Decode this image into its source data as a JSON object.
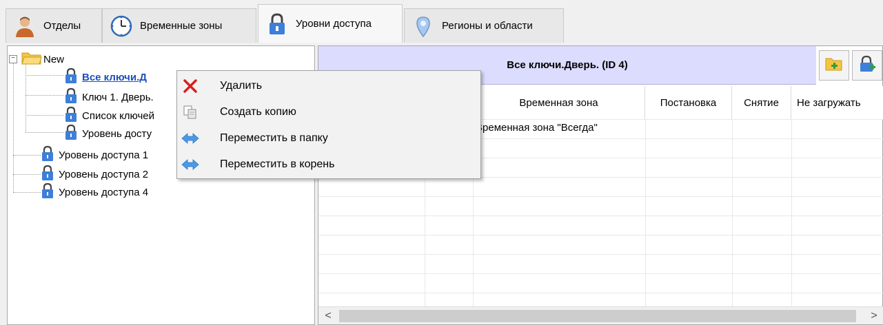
{
  "tabs": [
    {
      "label": "Отделы",
      "icon": "person-icon"
    },
    {
      "label": "Временные зоны",
      "icon": "clock-icon"
    },
    {
      "label": "Уровни доступа",
      "icon": "padlock-icon",
      "active": true
    },
    {
      "label": "Регионы и области",
      "icon": "map-pin-icon"
    }
  ],
  "tree": {
    "folder": "New",
    "children": [
      "Все ключи.Д",
      "Ключ 1. Дверь.",
      "Список ключей",
      "Уровень досту"
    ],
    "root_items": [
      "Уровень доступа 1",
      "Уровень доступа 2",
      "Уровень доступа 4"
    ]
  },
  "detail": {
    "title": "Все ключи.Дверь. (ID 4)",
    "columns": [
      "Временная зона",
      "Постановка",
      "Снятие",
      "Не загружать"
    ],
    "rows": [
      {
        "time_zone": "Временная зона \"Всегда\""
      }
    ]
  },
  "context_menu": {
    "items": [
      {
        "label": "Удалить",
        "icon": "delete-icon"
      },
      {
        "label": "Создать копию",
        "icon": "copy-icon"
      },
      {
        "label": "Переместить в папку",
        "icon": "move-arrow-icon"
      },
      {
        "label": "Переместить в корень",
        "icon": "move-arrow-icon"
      }
    ]
  },
  "scrollbar": {
    "left_arrow": "<",
    "right_arrow": ">"
  },
  "colors": {
    "header_bg": "#dcdcff",
    "lock": "#3d7fd9",
    "selected_text": "#1b4fbf",
    "delete": "#d81e1e",
    "folder": "#f5c542"
  }
}
